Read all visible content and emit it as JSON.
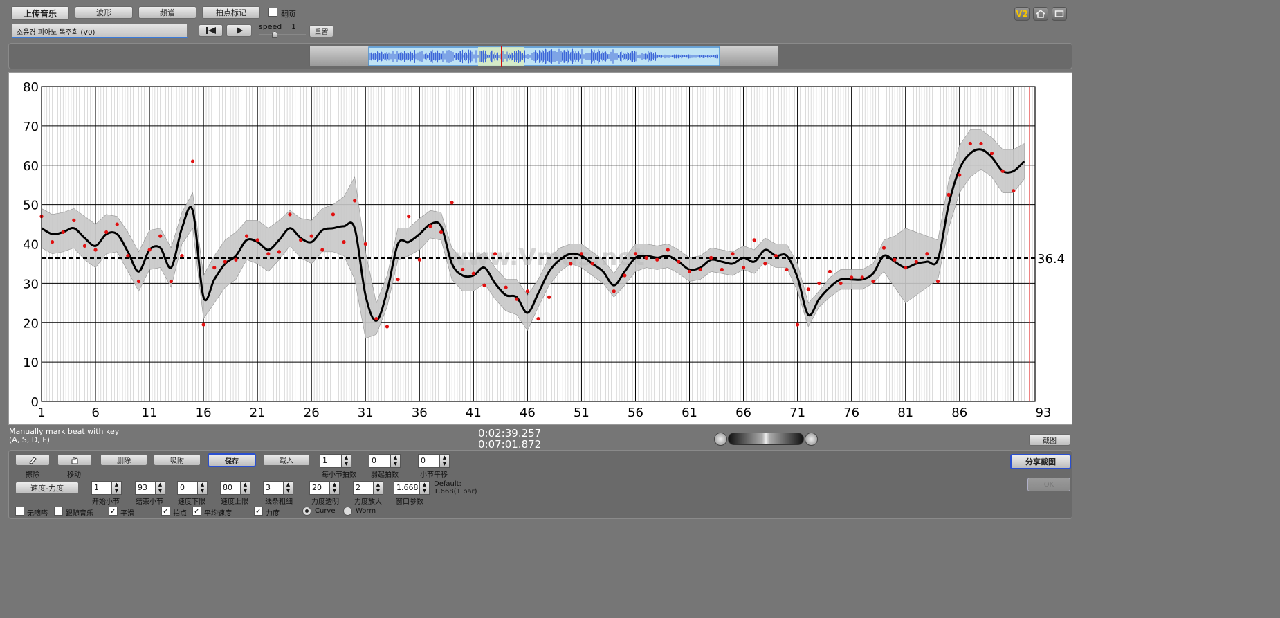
{
  "toolbar": {
    "upload": "上传音乐",
    "waveform": "波形",
    "spectrum": "频谱",
    "beat_mark": "拍点标记",
    "flip_page": "翻页",
    "track_title": "소윤경 피아노 독주회 (V0)",
    "speed_label": "speed",
    "speed_value": "1",
    "reset": "重置"
  },
  "right_icons": {
    "v2": "V2"
  },
  "status": {
    "hint_line1": "Manually mark beat with key",
    "hint_line2": "(A, S, D, F)",
    "time_current": "0:02:39.257",
    "time_total": "0:07:01.872"
  },
  "controls": {
    "screenshot": "截图",
    "share_screenshot": "分享截图",
    "ok": "OK",
    "erase": "擦除",
    "move": "移动",
    "erase_label": "擦除",
    "move_label": "移动",
    "delete": "删除",
    "snap": "吸附",
    "save": "保存",
    "load": "载入",
    "bar_beats": {
      "value": "1",
      "label": "每小节拍数"
    },
    "start_beat": {
      "value": "0",
      "label": "弱起拍数"
    },
    "bar_shift": {
      "value": "0",
      "label": "小节平移"
    },
    "mode": "速度-力度",
    "start_bar": {
      "value": "1",
      "label": "开始小节"
    },
    "end_bar": {
      "value": "93",
      "label": "结束小节"
    },
    "tempo_min": {
      "value": "0",
      "label": "速度下限"
    },
    "tempo_max": {
      "value": "80",
      "label": "速度上限"
    },
    "line_width": {
      "value": "3",
      "label": "线条粗细"
    },
    "dyn_opacity": {
      "value": "20",
      "label": "力度透明"
    },
    "dyn_scale": {
      "value": "2",
      "label": "力度放大"
    },
    "window_param": {
      "value": "1.668",
      "label": "窗口参数"
    },
    "default_line1": "Default:",
    "default_line2": "1.668(1 bar)",
    "cb_no_metronome": "无嘀嗒",
    "cb_follow_music": "跟随音乐",
    "cb_smooth": "平滑",
    "cb_beats": "拍点",
    "cb_avg_tempo": "平均速度",
    "cb_dynamics": "力度",
    "radio_curve": "Curve",
    "radio_worm": "Worm"
  },
  "chart_data": {
    "type": "line",
    "ylim": [
      0,
      80
    ],
    "y_ticks": [
      "0",
      "10",
      "20",
      "30",
      "40",
      "50",
      "60",
      "70",
      "80"
    ],
    "x_range": [
      1,
      93
    ],
    "x_ticks": [
      "1",
      "6",
      "11",
      "16",
      "21",
      "26",
      "31",
      "36",
      "41",
      "46",
      "51",
      "56",
      "61",
      "66",
      "71",
      "76",
      "81",
      "86",
      "93"
    ],
    "average_label": "36.4",
    "average": 36.4,
    "playhead_bar": 92.5,
    "watermark": "www.Vmus.net",
    "curve_color": "#000000",
    "point_color": "#e01010",
    "band_color": "#c8c8c8",
    "smoothed_curve": {
      "x": [
        1,
        2,
        3,
        4,
        5,
        6,
        7,
        8,
        9,
        10,
        11,
        12,
        13,
        14,
        15,
        16,
        17,
        18,
        19,
        20,
        21,
        22,
        23,
        24,
        25,
        26,
        27,
        28,
        29,
        30,
        31,
        32,
        33,
        34,
        35,
        36,
        37,
        38,
        39,
        40,
        41,
        42,
        43,
        44,
        45,
        46,
        47,
        48,
        49,
        50,
        51,
        52,
        53,
        54,
        55,
        56,
        57,
        58,
        59,
        60,
        61,
        62,
        63,
        64,
        65,
        66,
        67,
        68,
        69,
        70,
        71,
        72,
        73,
        74,
        75,
        76,
        77,
        78,
        79,
        80,
        81,
        82,
        83,
        84,
        85,
        86,
        87,
        88,
        89,
        90,
        91,
        92
      ],
      "y": [
        44,
        42.5,
        43,
        44,
        41.5,
        39.5,
        42.5,
        42.5,
        38,
        33,
        38.5,
        39,
        34,
        44,
        48.5,
        26.5,
        31,
        35,
        37,
        41,
        40.5,
        38.5,
        41,
        44,
        41.5,
        40.5,
        43.5,
        44,
        44.5,
        44,
        27,
        20.5,
        28,
        40,
        40.5,
        42.5,
        45,
        44.5,
        35,
        32,
        32,
        34,
        30,
        27,
        26.5,
        22.5,
        27.5,
        33,
        36,
        37.5,
        37,
        35,
        33,
        29.5,
        33,
        36.5,
        37,
        36.5,
        37,
        35.5,
        33.5,
        34,
        36,
        35.5,
        35,
        36.5,
        35.5,
        38.5,
        37,
        37,
        31.5,
        22,
        26,
        29,
        31,
        31,
        31,
        32.5,
        37,
        35.5,
        34,
        35,
        35.5,
        36,
        50,
        59,
        63,
        64,
        62,
        58.5,
        58.5,
        61
      ]
    },
    "band_upper": [
      49,
      47.5,
      48,
      49,
      47,
      45,
      47.5,
      47,
      43,
      38,
      43.5,
      44,
      39,
      48,
      53,
      32,
      37,
      41,
      43,
      46,
      46,
      44,
      46,
      48.5,
      46.5,
      46,
      49,
      50,
      52,
      57,
      38,
      25,
      32,
      44,
      44,
      46.5,
      48.5,
      48,
      39,
      36,
      36,
      38,
      34,
      31,
      31,
      27,
      31,
      36.5,
      39,
      40,
      40,
      38,
      36,
      32.5,
      36.5,
      40,
      40,
      39.5,
      40,
      38.5,
      36.5,
      37,
      39,
      38.5,
      38,
      39.5,
      38.5,
      41.5,
      40,
      40,
      35,
      25,
      28,
      31.5,
      33.5,
      33.5,
      33.5,
      35,
      41,
      42,
      44,
      43,
      42,
      41,
      56,
      65,
      69,
      69,
      67,
      64,
      64,
      65.5
    ],
    "band_lower": [
      39,
      37.5,
      38,
      39,
      36,
      34,
      37.5,
      38,
      33,
      28,
      33.5,
      34,
      29,
      40,
      44,
      21,
      25,
      29,
      31,
      36,
      35,
      33,
      36,
      39.5,
      36.5,
      35,
      38,
      38,
      37,
      31,
      16,
      17,
      24,
      36,
      37,
      38.5,
      41.5,
      41,
      31,
      28,
      28,
      30,
      26,
      23,
      22,
      18,
      24,
      29.5,
      33,
      35,
      34,
      32,
      30,
      26.5,
      29.5,
      33,
      34,
      33.5,
      34,
      32.5,
      30.5,
      31,
      33,
      32.5,
      32,
      33.5,
      32.5,
      35.5,
      34,
      34,
      28,
      19,
      24,
      26.5,
      28.5,
      28.5,
      28.5,
      30,
      33,
      29,
      25,
      27,
      29,
      31,
      44,
      53,
      57,
      59,
      57,
      53,
      53,
      56.5
    ],
    "beat_points": [
      [
        1,
        47
      ],
      [
        2,
        40.5
      ],
      [
        3,
        43
      ],
      [
        4,
        46
      ],
      [
        5,
        39.5
      ],
      [
        6,
        38.5
      ],
      [
        7,
        43
      ],
      [
        8,
        45
      ],
      [
        9,
        37
      ],
      [
        10,
        30.5
      ],
      [
        11,
        38.5
      ],
      [
        12,
        42
      ],
      [
        13,
        30.5
      ],
      [
        14,
        37
      ],
      [
        15,
        61
      ],
      [
        16,
        19.5
      ],
      [
        17,
        34
      ],
      [
        18,
        35.5
      ],
      [
        19,
        36
      ],
      [
        20,
        42
      ],
      [
        21,
        41
      ],
      [
        22,
        37.5
      ],
      [
        23,
        38
      ],
      [
        24,
        47.5
      ],
      [
        25,
        41
      ],
      [
        26,
        42
      ],
      [
        27,
        38.5
      ],
      [
        28,
        47.5
      ],
      [
        29,
        40.5
      ],
      [
        30,
        51
      ],
      [
        31,
        40
      ],
      [
        32,
        21
      ],
      [
        33,
        19
      ],
      [
        34,
        31
      ],
      [
        35,
        47
      ],
      [
        36,
        36
      ],
      [
        37,
        44.5
      ],
      [
        38,
        43
      ],
      [
        39,
        50.5
      ],
      [
        40,
        33.5
      ],
      [
        41,
        32.5
      ],
      [
        42,
        29.5
      ],
      [
        43,
        37.5
      ],
      [
        44,
        29
      ],
      [
        45,
        26
      ],
      [
        46,
        28
      ],
      [
        47,
        21
      ],
      [
        48,
        26.5
      ],
      [
        50,
        35
      ],
      [
        51,
        37.5
      ],
      [
        52,
        35
      ],
      [
        54,
        28
      ],
      [
        55,
        32
      ],
      [
        56,
        37.5
      ],
      [
        57,
        36.5
      ],
      [
        58,
        36
      ],
      [
        59,
        38.5
      ],
      [
        60,
        35.5
      ],
      [
        61,
        33
      ],
      [
        62,
        33.5
      ],
      [
        63,
        36.5
      ],
      [
        64,
        33.5
      ],
      [
        65,
        37.5
      ],
      [
        66,
        34
      ],
      [
        67,
        41
      ],
      [
        68,
        35
      ],
      [
        69,
        37
      ],
      [
        70,
        33.5
      ],
      [
        71,
        19.5
      ],
      [
        72,
        28.5
      ],
      [
        73,
        30
      ],
      [
        74,
        33
      ],
      [
        75,
        30
      ],
      [
        76,
        31.5
      ],
      [
        77,
        31.5
      ],
      [
        78,
        30.5
      ],
      [
        79,
        39
      ],
      [
        80,
        36
      ],
      [
        81,
        34
      ],
      [
        82,
        35.5
      ],
      [
        83,
        37.5
      ],
      [
        84,
        30.5
      ],
      [
        85,
        52.5
      ],
      [
        86,
        57.5
      ],
      [
        87,
        65.5
      ],
      [
        88,
        65.5
      ],
      [
        89,
        63
      ],
      [
        90,
        58.5
      ],
      [
        91,
        53.5
      ]
    ]
  }
}
